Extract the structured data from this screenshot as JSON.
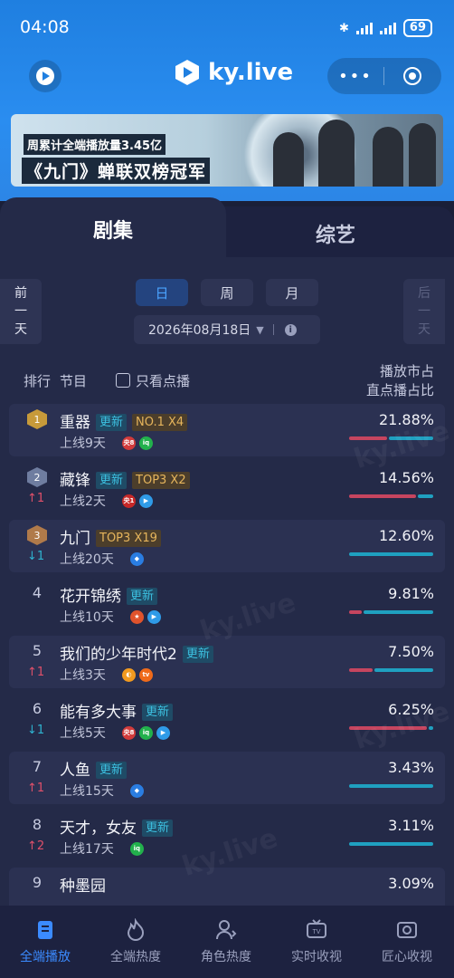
{
  "status_bar": {
    "time": "04:08",
    "battery": "69"
  },
  "header": {
    "logo_text": "ky.live",
    "more_label": "•••"
  },
  "banner": {
    "line1": "周累计全端播放量3.45亿",
    "line2": "《九门》蝉联双榜冠军"
  },
  "tabs": [
    {
      "label": "剧集",
      "active": true
    },
    {
      "label": "综艺",
      "active": false
    }
  ],
  "date_nav": {
    "prev_label": [
      "前",
      "一",
      "天"
    ],
    "next_label": [
      "后",
      "一",
      "天"
    ]
  },
  "periods": [
    {
      "label": "日",
      "active": true
    },
    {
      "label": "周",
      "active": false
    },
    {
      "label": "月",
      "active": false
    }
  ],
  "date": {
    "value": "2026年08月18日",
    "caret": "▼",
    "info": "i"
  },
  "columns": {
    "rank": "排行",
    "program": "节目",
    "only_vod": "只看点播",
    "right_line1": "播放市占",
    "right_line2": "直点播占比"
  },
  "colors": {
    "accent": "#3b8bff",
    "vod_bar": "#c6455f",
    "live_bar": "#1fa0c0",
    "update_badge": "#3cc0e0",
    "top_badge": "#e6b55c"
  },
  "rows": [
    {
      "rank": "1",
      "medal": "gold",
      "title": "重器",
      "badges": [
        {
          "text": "更新",
          "type": "update"
        },
        {
          "text": "NO.1 X4",
          "type": "top"
        }
      ],
      "change_dir": "",
      "change": "",
      "online": "上线9天",
      "platforms": [
        "cctv8-icon",
        "iqiyi-icon"
      ],
      "share": "21.88%",
      "vod_ratio": 0.45
    },
    {
      "rank": "2",
      "medal": "silver",
      "title": "藏锋",
      "badges": [
        {
          "text": "更新",
          "type": "update"
        },
        {
          "text": "TOP3 X2",
          "type": "top"
        }
      ],
      "change_dir": "up",
      "change": "1",
      "online": "上线2天",
      "platforms": [
        "cctv1-icon",
        "tencent-video-icon"
      ],
      "share": "14.56%",
      "vod_ratio": 0.8
    },
    {
      "rank": "3",
      "medal": "bronze",
      "title": "九门",
      "badges": [
        {
          "text": "TOP3 X19",
          "type": "top"
        }
      ],
      "change_dir": "down",
      "change": "1",
      "online": "上线20天",
      "platforms": [
        "youku-icon"
      ],
      "share": "12.60%",
      "vod_ratio": 0.0
    },
    {
      "rank": "4",
      "medal": "",
      "title": "花开锦绣",
      "badges": [
        {
          "text": "更新",
          "type": "update"
        }
      ],
      "change_dir": "",
      "change": "",
      "online": "上线10天",
      "platforms": [
        "mango-tv-icon",
        "tencent-video-icon"
      ],
      "share": "9.81%",
      "vod_ratio": 0.15
    },
    {
      "rank": "5",
      "medal": "",
      "title": "我们的少年时代2",
      "badges": [
        {
          "text": "更新",
          "type": "update"
        }
      ],
      "change_dir": "up",
      "change": "1",
      "online": "上线3天",
      "platforms": [
        "hunan-tv-icon",
        "mgtv-icon"
      ],
      "share": "7.50%",
      "vod_ratio": 0.28
    },
    {
      "rank": "6",
      "medal": "",
      "title": "能有多大事",
      "badges": [
        {
          "text": "更新",
          "type": "update"
        }
      ],
      "change_dir": "down",
      "change": "1",
      "online": "上线5天",
      "platforms": [
        "cctv8-icon",
        "iqiyi-icon",
        "tencent-video-icon"
      ],
      "share": "6.25%",
      "vod_ratio": 0.92
    },
    {
      "rank": "7",
      "medal": "",
      "title": "人鱼",
      "badges": [
        {
          "text": "更新",
          "type": "update"
        }
      ],
      "change_dir": "up",
      "change": "1",
      "online": "上线15天",
      "platforms": [
        "youku-icon"
      ],
      "share": "3.43%",
      "vod_ratio": 0.0
    },
    {
      "rank": "8",
      "medal": "",
      "title": "天才，女友",
      "badges": [
        {
          "text": "更新",
          "type": "update"
        }
      ],
      "change_dir": "up",
      "change": "2",
      "online": "上线17天",
      "platforms": [
        "iqiyi-icon"
      ],
      "share": "3.11%",
      "vod_ratio": 0.0
    },
    {
      "rank": "9",
      "medal": "",
      "title": "种墨园",
      "badges": [],
      "change_dir": "",
      "change": "",
      "online": "",
      "platforms": [],
      "share": "3.09%",
      "vod_ratio": 0.0
    }
  ],
  "nav": [
    {
      "label": "全端播放",
      "icon": "document-icon",
      "active": true
    },
    {
      "label": "全端热度",
      "icon": "flame-icon",
      "active": false
    },
    {
      "label": "角色热度",
      "icon": "person-flame-icon",
      "active": false
    },
    {
      "label": "实时收视",
      "icon": "tv-icon",
      "active": false
    },
    {
      "label": "匠心收视",
      "icon": "trophy-tv-icon",
      "active": false
    }
  ]
}
